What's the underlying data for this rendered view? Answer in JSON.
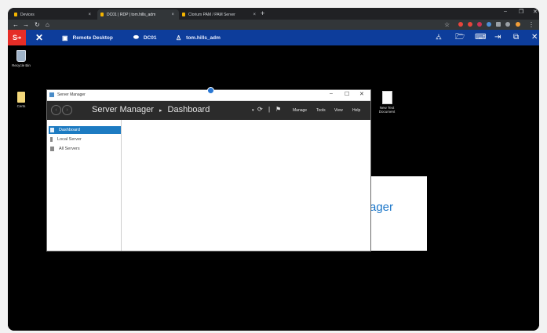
{
  "browser": {
    "tabs": [
      {
        "label": "Devices",
        "close": "×"
      },
      {
        "label": "DC01 | RDP | tom.hills_adm",
        "close": "×"
      },
      {
        "label": "Clorium PAM / PAM Server",
        "close": "×"
      }
    ],
    "new_tab": "+",
    "window_controls": {
      "minimize": "–",
      "restore": "❐",
      "close": "✕"
    },
    "nav": {
      "back": "←",
      "forward": "→",
      "reload": "↻",
      "home": "⌂"
    },
    "extension_colors": [
      "#e8453c",
      "#e8453c",
      "#cc3355",
      "#4e8fd6",
      "#9aa0a6",
      "#9aa0a6",
      "#f29e38"
    ]
  },
  "rd_toolbar": {
    "logo": "S",
    "close_glyph": "✕",
    "items": [
      {
        "label": "Remote Desktop",
        "icon": "monitor-icon"
      },
      {
        "label": "DC01",
        "icon": "server-icon"
      },
      {
        "label": "tom.hills_adm",
        "icon": "user-icon"
      }
    ],
    "right_icons": [
      "network-icon",
      "folder-icon",
      "keyboard-icon",
      "exit-icon",
      "popout-icon",
      "close-icon"
    ],
    "color": "#0d3d9b",
    "logo_color": "#e52d27"
  },
  "desktop": {
    "icons": [
      {
        "label": "Recycle Bin"
      },
      {
        "label": "Certs"
      },
      {
        "label": "New Text Document"
      }
    ],
    "background_window_text": "ager"
  },
  "server_manager": {
    "window_title": "Server Manager",
    "controls": {
      "minimize": "–",
      "maximize": "☐",
      "close": "✕"
    },
    "header": {
      "breadcrumb_app": "Server Manager",
      "separator": "▸",
      "breadcrumb_page": "Dashboard",
      "menu": [
        "Manage",
        "Tools",
        "View",
        "Help"
      ]
    },
    "sidebar": [
      {
        "label": "Dashboard",
        "selected": true
      },
      {
        "label": "Local Server",
        "selected": false
      },
      {
        "label": "All Servers",
        "selected": false
      }
    ],
    "accent": "#1d7bc2"
  }
}
